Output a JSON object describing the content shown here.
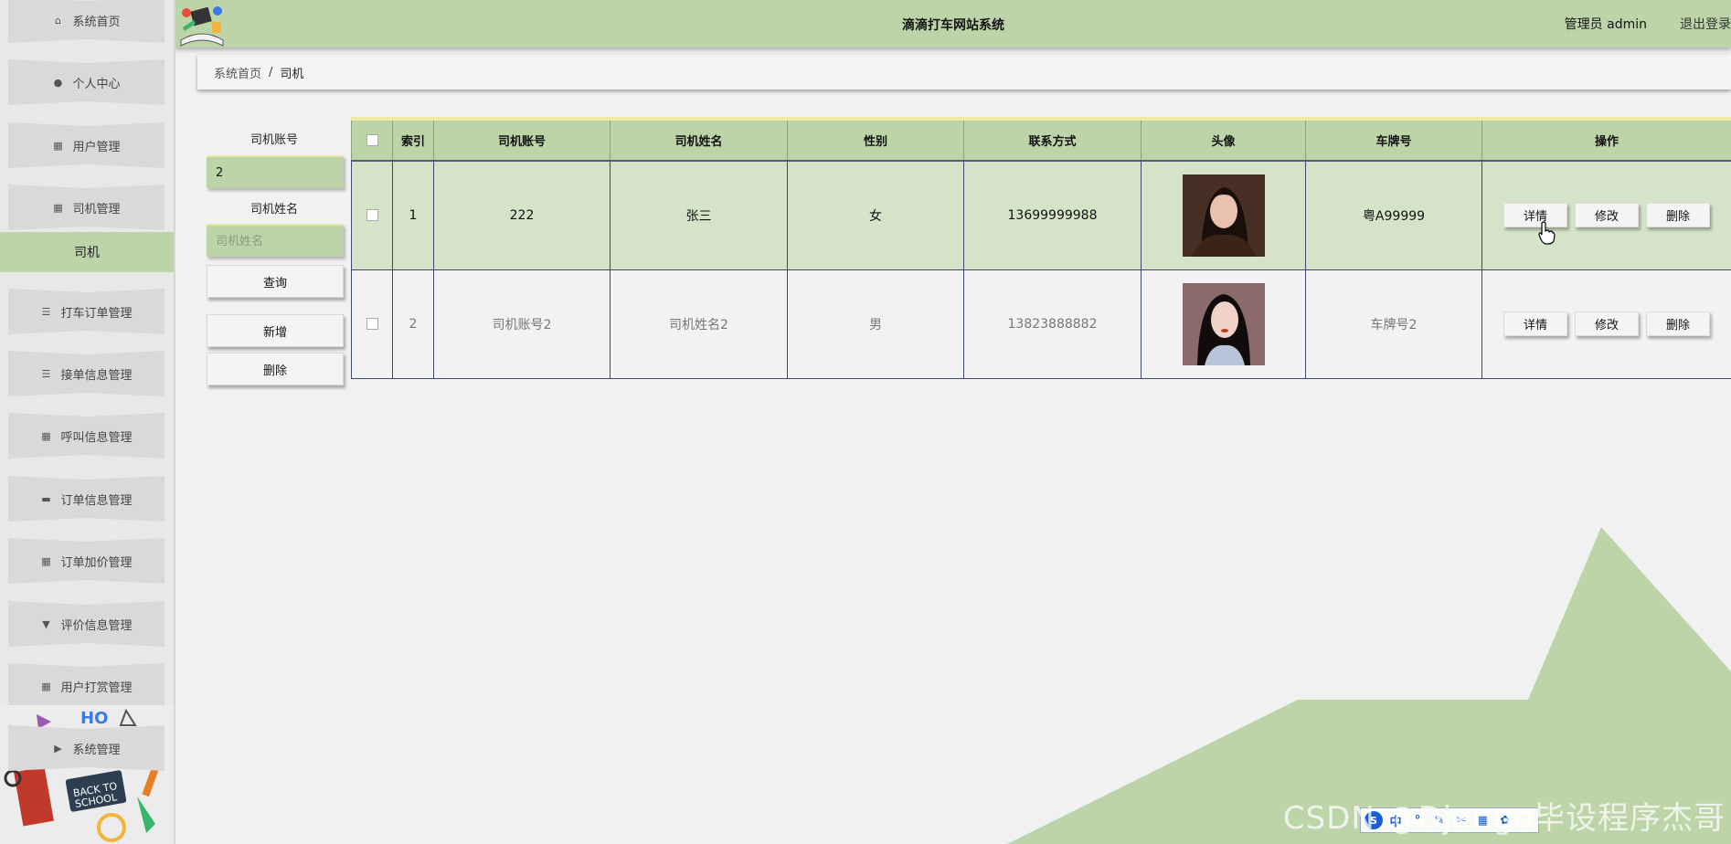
{
  "header": {
    "title": "滴滴打车网站系统",
    "admin": "管理员 admin",
    "logout": "退出登录"
  },
  "sidebar": {
    "items": [
      {
        "label": "系统首页",
        "icon": "home-icon"
      },
      {
        "label": "个人中心",
        "icon": "user-icon"
      },
      {
        "label": "用户管理",
        "icon": "grid-icon"
      },
      {
        "label": "司机管理",
        "icon": "grid-icon"
      },
      {
        "label": "打车订单管理",
        "icon": "list-icon"
      },
      {
        "label": "接单信息管理",
        "icon": "list-icon"
      },
      {
        "label": "呼叫信息管理",
        "icon": "grid-icon"
      },
      {
        "label": "订单信息管理",
        "icon": "printer-icon"
      },
      {
        "label": "订单加价管理",
        "icon": "grid-icon"
      },
      {
        "label": "评价信息管理",
        "icon": "comment-icon"
      },
      {
        "label": "用户打赏管理",
        "icon": "grid-icon"
      },
      {
        "label": "系统管理",
        "icon": "video-icon"
      }
    ],
    "active": "司机"
  },
  "breadcrumb": {
    "home": "系统首页",
    "separator": "/",
    "current": "司机"
  },
  "search": {
    "account_label": "司机账号",
    "account_value": "2",
    "name_label": "司机姓名",
    "name_placeholder": "司机姓名",
    "query_button": "查询",
    "add_button": "新增",
    "delete_button": "删除"
  },
  "table": {
    "headers": [
      "索引",
      "司机账号",
      "司机姓名",
      "性别",
      "联系方式",
      "头像",
      "车牌号",
      "操作"
    ],
    "rows": [
      {
        "index": "1",
        "account": "222",
        "name": "张三",
        "gender": "女",
        "phone": "13699999988",
        "plate": "粤A99999"
      },
      {
        "index": "2",
        "account": "司机账号2",
        "name": "司机姓名2",
        "gender": "男",
        "phone": "13823888882",
        "plate": "车牌号2"
      }
    ],
    "actions": {
      "detail": "详情",
      "edit": "修改",
      "delete": "删除"
    }
  },
  "watermark": "CSDN @Django毕设程序杰哥",
  "ime": [
    "中",
    "°",
    "✎",
    "✂",
    "▦",
    "✿"
  ],
  "colors": {
    "accent": "#bdd4a8",
    "active_row": "#d5e4c8",
    "header_border": "#f0e9a8"
  }
}
